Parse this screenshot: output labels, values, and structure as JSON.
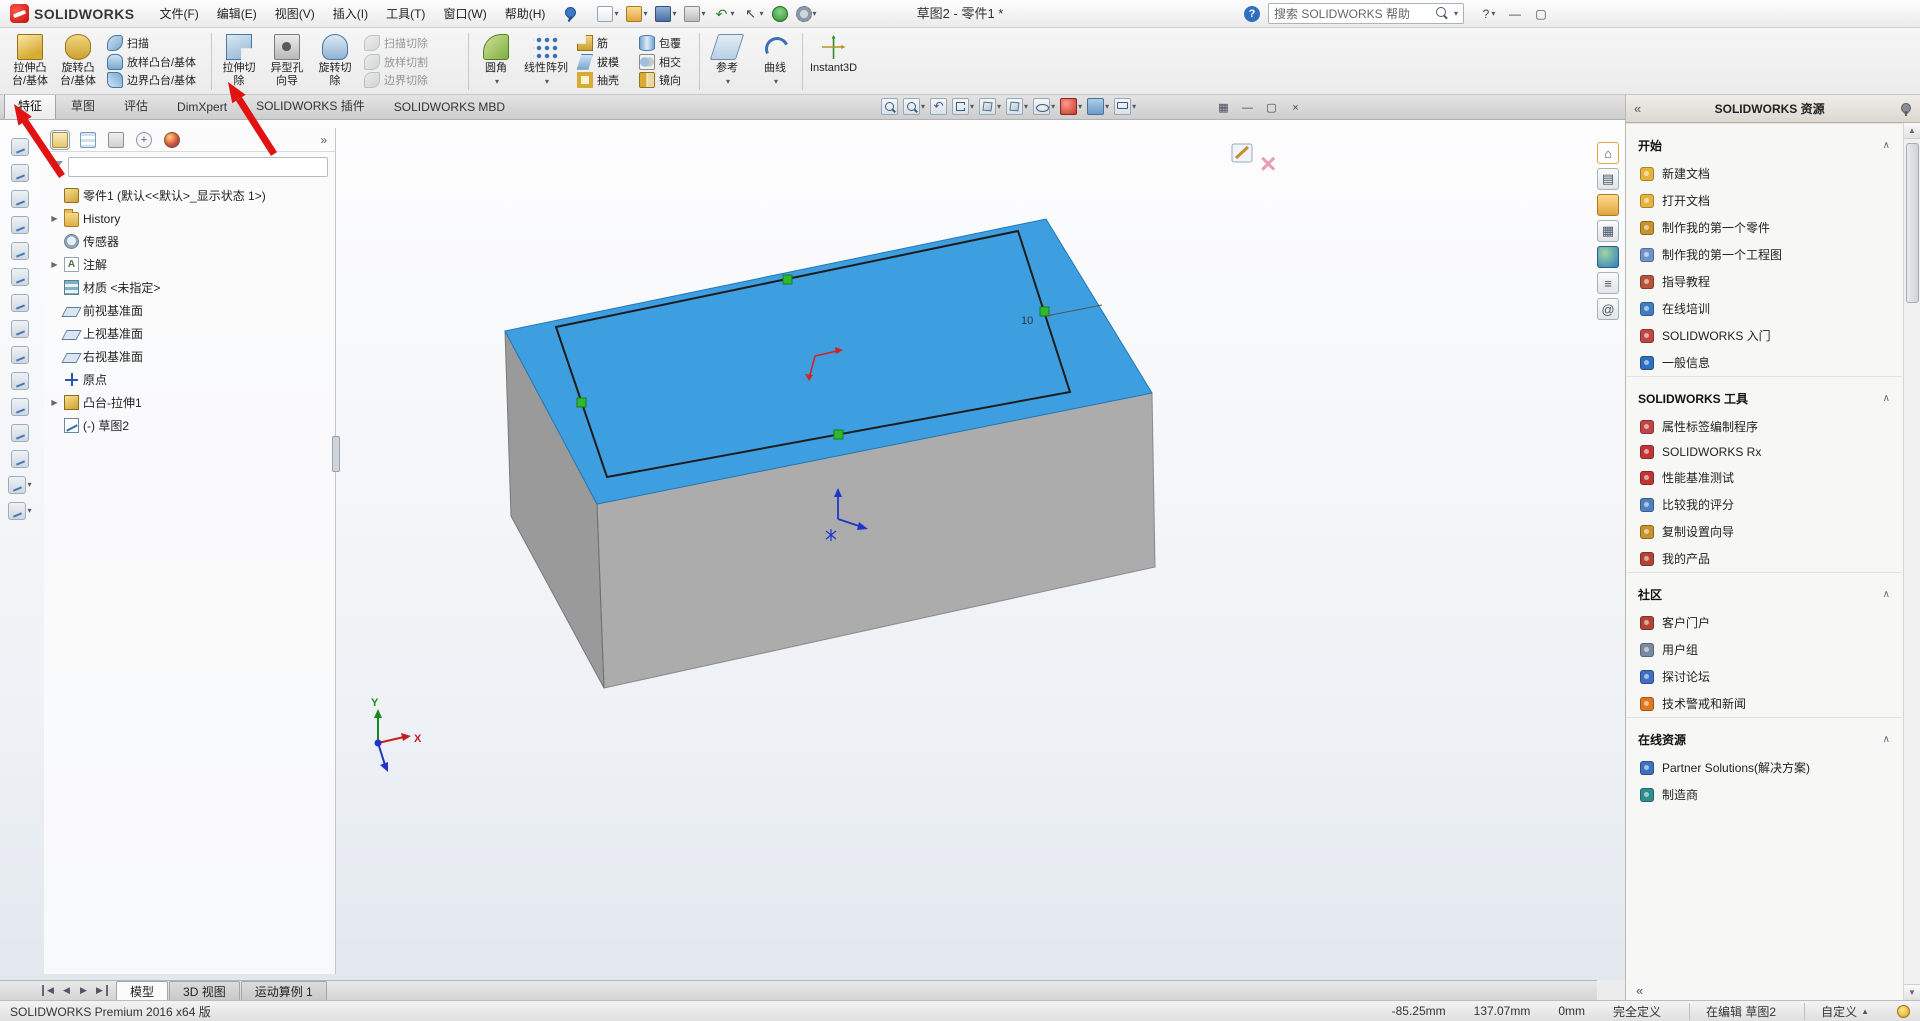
{
  "titlebar": {
    "logo_text": "SOLIDWORKS",
    "menus": [
      "文件(F)",
      "编辑(E)",
      "视图(V)",
      "插入(I)",
      "工具(T)",
      "窗口(W)",
      "帮助(H)"
    ],
    "quick_tools": [
      {
        "name": "new-document",
        "arrow": true
      },
      {
        "name": "open-document",
        "arrow": true
      },
      {
        "name": "save",
        "arrow": true
      },
      {
        "name": "print",
        "arrow": true
      },
      {
        "name": "undo",
        "arrow": true
      },
      {
        "name": "select",
        "arrow": true
      },
      {
        "name": "rebuild"
      },
      {
        "name": "options",
        "arrow": true
      }
    ],
    "doc_title": "草图2 - 零件1 *",
    "help_badge": "?",
    "search_placeholder": "搜索 SOLIDWORKS 帮助",
    "window_controls": [
      {
        "name": "help",
        "glyph": "?",
        "arrow": true
      },
      {
        "name": "minimize",
        "glyph": "—"
      },
      {
        "name": "restore",
        "glyph": "▢"
      }
    ]
  },
  "ribbon": {
    "seg1_large": [
      {
        "name": "extruded-boss-base-button",
        "icon": "extrude-boss",
        "line1": "拉伸凸",
        "line2": "台/基体"
      },
      {
        "name": "revolved-boss-base-button",
        "icon": "revolve-boss",
        "line1": "旋转凸",
        "line2": "台/基体"
      }
    ],
    "col1": [
      {
        "name": "swept-boss-base-button",
        "icon": "sweep",
        "label": "扫描"
      },
      {
        "name": "lofted-boss-base-button",
        "icon": "loft",
        "label": "放样凸台/基体"
      },
      {
        "name": "boundary-boss-base-button",
        "icon": "boundary",
        "label": "边界凸台/基体"
      }
    ],
    "seg2_large": [
      {
        "name": "extruded-cut-button",
        "icon": "extrude-cut",
        "line1": "拉伸切",
        "line2": "除"
      },
      {
        "name": "hole-wizard-button",
        "icon": "hole-wizard",
        "line1": "异型孔",
        "line2": "向导"
      },
      {
        "name": "revolved-cut-button",
        "icon": "revolve-cut",
        "line1": "旋转切",
        "line2": "除"
      }
    ],
    "col2": [
      {
        "name": "swept-cut-button",
        "icon": "sweep-cut",
        "label": "扫描切除",
        "disabled": true
      },
      {
        "name": "lofted-cut-button",
        "icon": "loft-cut",
        "label": "放样切割",
        "disabled": true
      },
      {
        "name": "boundary-cut-button",
        "icon": "boundary-cut",
        "label": "边界切除",
        "disabled": true
      }
    ],
    "seg3_large": [
      {
        "name": "fillet-button",
        "icon": "fillet",
        "line1": "圆角",
        "line2": "",
        "arrow": true
      },
      {
        "name": "linear-pattern-button",
        "icon": "linear-pattern",
        "line1": "线性阵列",
        "line2": "",
        "arrow": true
      }
    ],
    "col3": [
      {
        "name": "rib-button",
        "icon": "rib",
        "label": "筋"
      },
      {
        "name": "draft-button",
        "icon": "draft",
        "label": "拔模"
      },
      {
        "name": "shell-button",
        "icon": "shell",
        "label": "抽壳"
      }
    ],
    "col4": [
      {
        "name": "wrap-button",
        "icon": "wrap",
        "label": "包覆"
      },
      {
        "name": "intersect-button",
        "icon": "intersect",
        "label": "相交"
      },
      {
        "name": "mirror-button",
        "icon": "mirror",
        "label": "镜向"
      }
    ],
    "seg4_large": [
      {
        "name": "reference-geometry-button",
        "icon": "reference",
        "line1": "参考",
        "line2": "",
        "arrow": true
      },
      {
        "name": "curves-button",
        "icon": "curves",
        "line1": "曲线",
        "line2": "",
        "arrow": true
      }
    ],
    "seg5_large": [
      {
        "name": "instant3d-button",
        "icon": "instant3d",
        "line1": "Instant3D",
        "line2": ""
      }
    ]
  },
  "command_tabs": [
    {
      "label": "特征",
      "active": true
    },
    {
      "label": "草图"
    },
    {
      "label": "评估"
    },
    {
      "label": "DimXpert"
    },
    {
      "label": "SOLIDWORKS 插件"
    },
    {
      "label": "SOLIDWORKS MBD"
    }
  ],
  "headsup": [
    {
      "name": "zoom-fit"
    },
    {
      "name": "zoom-area",
      "arrow": true
    },
    {
      "name": "previous-view"
    },
    {
      "name": "section-view",
      "arrow": true
    },
    {
      "name": "view-orientation",
      "arrow": true
    },
    {
      "name": "display-style",
      "arrow": true
    },
    {
      "name": "hide-show-items",
      "arrow": true
    },
    {
      "name": "edit-appearance",
      "arrow": true
    },
    {
      "name": "apply-scene",
      "arrow": true
    },
    {
      "name": "view-settings",
      "arrow": true
    }
  ],
  "doc_window_controls": [
    {
      "name": "cascade-doc",
      "glyph": "▦"
    },
    {
      "name": "minimize-doc",
      "glyph": "—"
    },
    {
      "name": "restore-doc",
      "glyph": "▢"
    },
    {
      "name": "close-doc",
      "glyph": "×"
    }
  ],
  "left_toolbar": [
    {
      "name": "select-tool"
    },
    {
      "name": "edit-sketch"
    },
    {
      "name": "smart-dimension"
    },
    {
      "name": "sketch-line"
    },
    {
      "name": "sketch-circle"
    },
    {
      "name": "sketch-arc"
    },
    {
      "name": "sketch-rectangle"
    },
    {
      "name": "trim-entities"
    },
    {
      "name": "convert-entities"
    },
    {
      "name": "offset-entities"
    },
    {
      "name": "mirror-entities"
    },
    {
      "name": "sketch-pattern"
    },
    {
      "name": "display-relations"
    },
    {
      "name": "quick-snaps",
      "arrow": true
    },
    {
      "name": "rapid-sketch",
      "arrow": true
    }
  ],
  "feature_tree": {
    "tabs": [
      {
        "name": "featuremanager-design-tree",
        "active": true
      },
      {
        "name": "propertymanager"
      },
      {
        "name": "configurationmanager"
      },
      {
        "name": "dimxpertmanager"
      },
      {
        "name": "displaymanager"
      }
    ],
    "chevron": "»",
    "items": [
      {
        "icon": "part",
        "label": "零件1 (默认<<默认>_显示状态 1>)"
      },
      {
        "icon": "history",
        "label": "History",
        "expand": true
      },
      {
        "icon": "sensors",
        "label": "传感器"
      },
      {
        "icon": "annotations",
        "label": "注解",
        "expand": true
      },
      {
        "icon": "material",
        "label": "材质 <未指定>"
      },
      {
        "icon": "plane",
        "label": "前视基准面"
      },
      {
        "icon": "plane",
        "label": "上视基准面"
      },
      {
        "icon": "plane",
        "label": "右视基准面"
      },
      {
        "icon": "origin",
        "label": "原点"
      },
      {
        "icon": "boss",
        "label": "凸台-拉伸1",
        "expand": true
      },
      {
        "icon": "sketch",
        "label": "(-) 草图2"
      }
    ]
  },
  "viewport": {
    "dimension_label": "10",
    "triad": {
      "x": "X",
      "y": "Y"
    }
  },
  "colors": {
    "face_top": "#3d9fe0",
    "face_front": "#acacac",
    "face_left": "#9a9a9a",
    "handle_green": "#2db82d",
    "annotation_red": "#e01212"
  },
  "taskpane": {
    "collapse_glyph": "«",
    "title": "SOLIDWORKS 资源",
    "foot_prev": "«",
    "foot_next": "»",
    "sections": [
      {
        "title": "开始",
        "items": [
          {
            "icon": "new-document",
            "label": "新建文档",
            "color": "#e8b33c"
          },
          {
            "icon": "open-document",
            "label": "打开文档",
            "color": "#e8b33c"
          },
          {
            "icon": "first-part",
            "label": "制作我的第一个零件",
            "color": "#c8922f"
          },
          {
            "icon": "first-drawing",
            "label": "制作我的第一个工程图",
            "color": "#6f94c8"
          },
          {
            "icon": "tutorials",
            "label": "指导教程",
            "color": "#b5543a"
          },
          {
            "icon": "online-training",
            "label": "在线培训",
            "color": "#3f7fbf"
          },
          {
            "icon": "sw-getting-started",
            "label": "SOLIDWORKS 入门",
            "color": "#c04545"
          },
          {
            "icon": "general-info",
            "label": "一般信息",
            "color": "#2f6fbf"
          }
        ]
      },
      {
        "title": "SOLIDWORKS 工具",
        "items": [
          {
            "icon": "property-tab-builder",
            "label": "属性标签编制程序",
            "color": "#c04545"
          },
          {
            "icon": "solidworks-rx",
            "label": "SOLIDWORKS Rx",
            "color": "#c03535"
          },
          {
            "icon": "performance-benchmark",
            "label": "性能基准测试",
            "color": "#c03535"
          },
          {
            "icon": "compare-my-score",
            "label": "比较我的评分",
            "color": "#4f7fbf"
          },
          {
            "icon": "copy-settings-wizard",
            "label": "复制设置向导",
            "color": "#c8922f"
          },
          {
            "icon": "my-products",
            "label": "我的产品",
            "color": "#b04535"
          }
        ]
      },
      {
        "title": "社区",
        "items": [
          {
            "icon": "customer-portal",
            "label": "客户门户",
            "color": "#b04535"
          },
          {
            "icon": "user-groups",
            "label": "用户组",
            "color": "#7a8aa0"
          },
          {
            "icon": "discussion-forum",
            "label": "探讨论坛",
            "color": "#3f6fbf"
          },
          {
            "icon": "tech-alerts-news",
            "label": "技术警戒和新闻",
            "color": "#e07820"
          }
        ]
      },
      {
        "title": "在线资源",
        "items": [
          {
            "icon": "partner-solutions",
            "label": "Partner Solutions(解决方案)",
            "color": "#3f6fbf"
          },
          {
            "icon": "manufacturer",
            "label": "制造商",
            "color": "#2f8f8f"
          }
        ]
      }
    ]
  },
  "taskpane_tabs": [
    {
      "name": "solidworks-resources",
      "glyph": "⌂",
      "active": true
    },
    {
      "name": "design-library",
      "glyph": "▤"
    },
    {
      "name": "file-explorer",
      "glyph": "",
      "icon": "folder"
    },
    {
      "name": "view-palette",
      "glyph": "▦"
    },
    {
      "name": "appearances-scenes",
      "glyph": "",
      "icon": "ball"
    },
    {
      "name": "custom-properties",
      "glyph": "≡"
    },
    {
      "name": "solidworks-forum",
      "glyph": "@"
    }
  ],
  "docbar": {
    "nav": [
      {
        "name": "first-tab",
        "glyph": "◀",
        "edge": true
      },
      {
        "name": "previous-tab",
        "glyph": "◀"
      },
      {
        "name": "next-tab",
        "glyph": "▶"
      },
      {
        "name": "last-tab",
        "glyph": "▶",
        "edge_r": true
      }
    ],
    "tabs": [
      {
        "label": "模型",
        "active": true
      },
      {
        "label": "3D 视图"
      },
      {
        "label": "运动算例 1"
      }
    ]
  },
  "statusbar": {
    "left": "SOLIDWORKS Premium 2016 x64 版",
    "coords": [
      "-85.25mm",
      "137.07mm",
      "0mm"
    ],
    "state": "完全定义",
    "editing": "在编辑 草图2",
    "custom": "自定义"
  }
}
